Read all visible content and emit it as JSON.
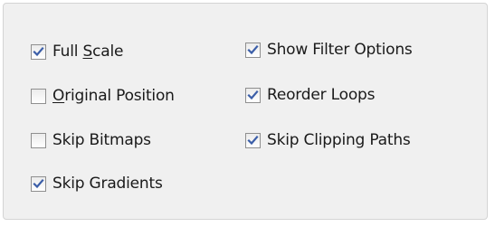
{
  "options": {
    "full_scale": {
      "label_pre": "Full ",
      "label_accel": "S",
      "label_post": "cale",
      "checked": true
    },
    "original_position": {
      "label_pre": "",
      "label_accel": "O",
      "label_post": "riginal Position",
      "checked": false
    },
    "skip_bitmaps": {
      "label": "Skip Bitmaps",
      "checked": false
    },
    "skip_gradients": {
      "label": "Skip Gradients",
      "checked": true
    },
    "show_filter_options": {
      "label": "Show Filter Options",
      "checked": true
    },
    "reorder_loops": {
      "label": "Reorder Loops",
      "checked": true
    },
    "skip_clipping_paths": {
      "label": "Skip Clipping Paths",
      "checked": true
    }
  },
  "colors": {
    "panel_bg": "#f0f0f0",
    "checkmark": "#3b5ea8",
    "checkbox_border": "#8f8f8f",
    "text": "#1a1a1a"
  }
}
